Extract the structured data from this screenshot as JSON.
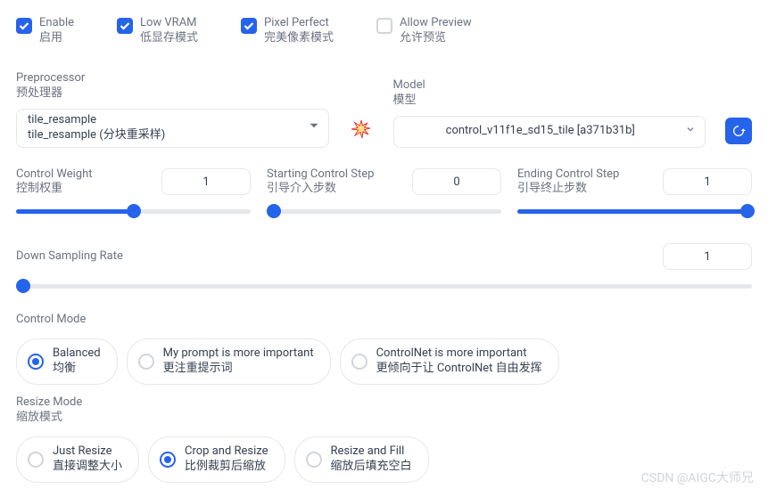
{
  "checkboxes": {
    "enable": {
      "en": "Enable",
      "zh": "启用",
      "checked": true
    },
    "low_vram": {
      "en": "Low VRAM",
      "zh": "低显存模式",
      "checked": true
    },
    "pixel_perfect": {
      "en": "Pixel Perfect",
      "zh": "完美像素模式",
      "checked": true
    },
    "allow_preview": {
      "en": "Allow Preview",
      "zh": "允许预览",
      "checked": false
    }
  },
  "preprocessor": {
    "label_en": "Preprocessor",
    "label_zh": "预处理器",
    "value_line1": "tile_resample",
    "value_line2": "tile_resample (分块重采样)"
  },
  "model": {
    "label_en": "Model",
    "label_zh": "模型",
    "value": "control_v11f1e_sd15_tile [a371b31b]"
  },
  "sliders": {
    "control_weight": {
      "label_en": "Control Weight",
      "label_zh": "控制权重",
      "value": "1",
      "fill_pct": 50
    },
    "start_step": {
      "label_en": "Starting Control Step",
      "label_zh": "引导介入步数",
      "value": "0",
      "fill_pct": 0
    },
    "end_step": {
      "label_en": "Ending Control Step",
      "label_zh": "引导终止步数",
      "value": "1",
      "fill_pct": 100
    },
    "down_sampling": {
      "label": "Down Sampling Rate",
      "value": "1",
      "fill_pct": 0
    }
  },
  "control_mode": {
    "label": "Control Mode",
    "options": [
      {
        "en": "Balanced",
        "zh": "均衡",
        "selected": true
      },
      {
        "en": "My prompt is more important",
        "zh": "更注重提示词",
        "selected": false
      },
      {
        "en": "ControlNet is more important",
        "zh": "更倾向于让 ControlNet 自由发挥",
        "selected": false
      }
    ]
  },
  "resize_mode": {
    "label_en": "Resize Mode",
    "label_zh": "缩放模式",
    "options": [
      {
        "en": "Just Resize",
        "zh": "直接调整大小",
        "selected": false
      },
      {
        "en": "Crop and Resize",
        "zh": "比例裁剪后缩放",
        "selected": true
      },
      {
        "en": "Resize and Fill",
        "zh": "缩放后填充空白",
        "selected": false
      }
    ]
  },
  "watermark": "CSDN @AIGC大师兄"
}
